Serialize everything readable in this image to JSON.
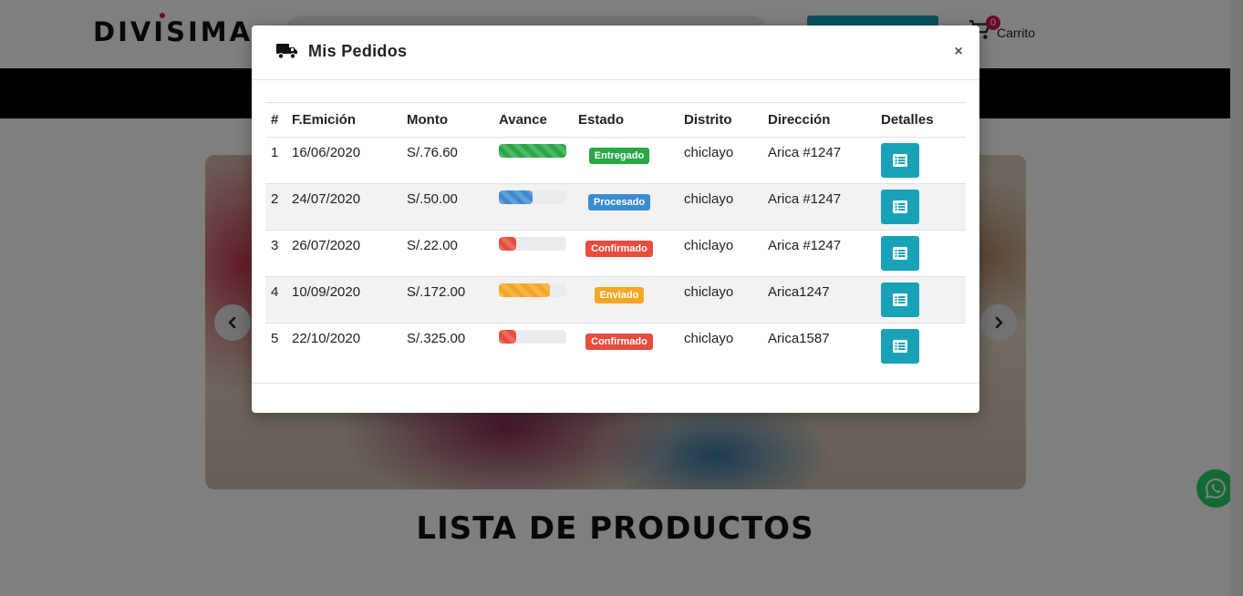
{
  "header": {
    "logo": "DIVISIMA",
    "cart_count": "0",
    "cart_label": "Carrito"
  },
  "main": {
    "section_title": "LISTA DE PRODUCTOS"
  },
  "modal": {
    "title": "Mis Pedidos",
    "close_symbol": "×",
    "columns": [
      "#",
      "F.Emición",
      "Monto",
      "Avance",
      "Estado",
      "Distrito",
      "Dirección",
      "Detalles"
    ],
    "orders": [
      {
        "num": "1",
        "fecha": "16/06/2020",
        "monto": "S/.76.60",
        "avance": 1.0,
        "avance_color": "#28a745",
        "estado": "Entregado",
        "estado_color": "#28a745",
        "distrito": "chiclayo",
        "direccion": "Arica #1247"
      },
      {
        "num": "2",
        "fecha": "24/07/2020",
        "monto": "S/.50.00",
        "avance": 0.5,
        "avance_color": "#3d8bd0",
        "estado": "Procesado",
        "estado_color": "#3d8bd0",
        "distrito": "chiclayo",
        "direccion": "Arica #1247"
      },
      {
        "num": "3",
        "fecha": "26/07/2020",
        "monto": "S/.22.00",
        "avance": 0.25,
        "avance_color": "#e74c3c",
        "estado": "Confirmado",
        "estado_color": "#e74c3c",
        "distrito": "chiclayo",
        "direccion": "Arica #1247"
      },
      {
        "num": "4",
        "fecha": "10/09/2020",
        "monto": "S/.172.00",
        "avance": 0.75,
        "avance_color": "#f5a623",
        "estado": "Enviado",
        "estado_color": "#f5a623",
        "distrito": "chiclayo",
        "direccion": "Arica1247"
      },
      {
        "num": "5",
        "fecha": "22/10/2020",
        "monto": "S/.325.00",
        "avance": 0.25,
        "avance_color": "#e74c3c",
        "estado": "Confirmado",
        "estado_color": "#e74c3c",
        "distrito": "chiclayo",
        "direccion": "Arica1587"
      }
    ]
  },
  "icons": {
    "modal_title": "truck-icon",
    "detail_button": "list-icon",
    "carousel_prev": "chevron-left-icon",
    "carousel_next": "chevron-right-icon",
    "floating": "whatsapp-icon",
    "cart": "cart-icon"
  },
  "colors": {
    "accent": "#17a2b8",
    "brand": "#d4145a",
    "nav": "#000000"
  }
}
